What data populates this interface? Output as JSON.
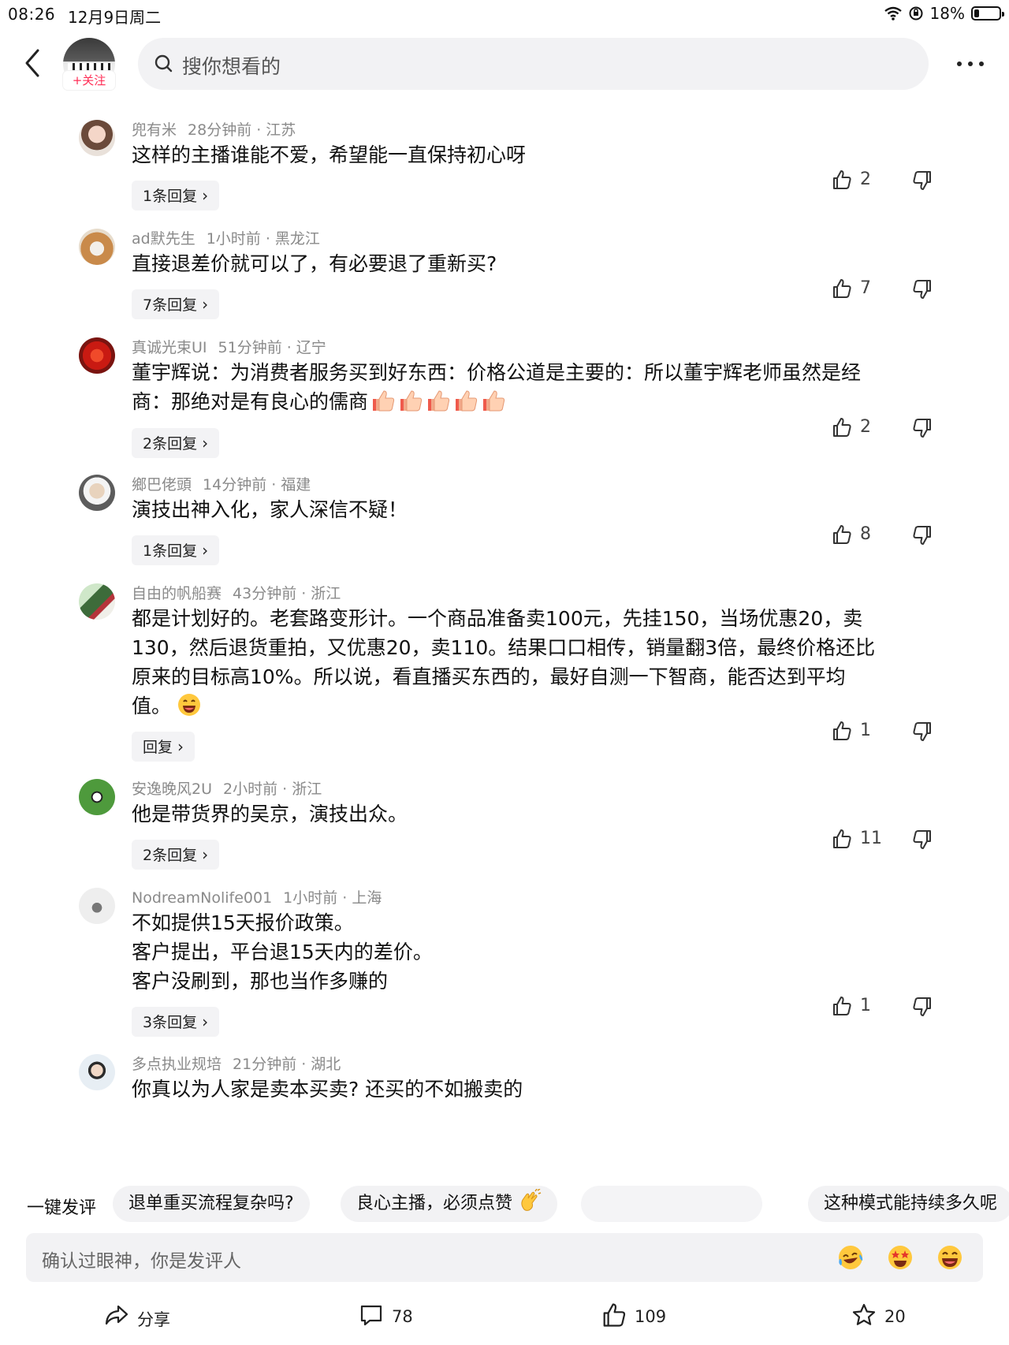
{
  "status_bar": {
    "time": "08:26",
    "date": "12月9日周二",
    "battery": "18%",
    "battery_level": 0.18
  },
  "header": {
    "follow_label": "+关注",
    "search_placeholder": "搜你想看的"
  },
  "comments": [
    {
      "user": "兜有米",
      "time": "28分钟前 · 江苏",
      "lines": [
        "这样的主播谁能不爱，希望能一直保持初心呀"
      ],
      "reply": "1条回复",
      "likes": "2"
    },
    {
      "user": "ad默先生",
      "time": "1小时前 · 黑龙江",
      "lines": [
        "直接退差价就可以了，有必要退了重新买?"
      ],
      "reply": "7条回复",
      "likes": "7"
    },
    {
      "user": "真诚光束UI",
      "time": "51分钟前 · 辽宁",
      "lines": [
        "董宇辉说：为消费者服务买到好东西：价格公道是主要的：所以董宇辉老师虽然是经",
        "商：那绝对是有良心的儒商"
      ],
      "emoji_count": 5,
      "reply": "2条回复",
      "likes": "2"
    },
    {
      "user": "鄉巴佬頭",
      "time": "14分钟前 · 福建",
      "lines": [
        "演技出神入化，家人深信不疑！"
      ],
      "reply": "1条回复",
      "likes": "8"
    },
    {
      "user": "自由的帆船赛",
      "time": "43分钟前 · 浙江",
      "lines": [
        "都是计划好的。老套路变形计。一个商品准备卖100元，先挂150，当场优惠20，卖",
        "130，然后退货重拍，又优惠20，卖110。结果口口相传，销量翻3倍，最终价格还比",
        "原来的目标高10%。所以说，看直播买东西的，最好自测一下智商，能否达到平均",
        "值。"
      ],
      "reply": "回复",
      "likes": "1"
    },
    {
      "user": "安逸晚风2U",
      "time": "2小时前 · 浙江",
      "lines": [
        "他是带货界的吴京，演技出众。"
      ],
      "reply": "2条回复",
      "likes": "11"
    },
    {
      "user": "NodreamNolife001",
      "time": "1小时前 · 上海",
      "lines": [
        "不如提供15天报价政策。",
        "客户提出，平台退15天内的差价。",
        "客户没刷到，那也当作多赚的"
      ],
      "reply": "3条回复",
      "likes": "1"
    },
    {
      "user": "多点执业规培",
      "time": "21分钟前 · 湖北",
      "lines": [
        "你真以为人家是卖本买卖? 还买的不如搬卖的"
      ]
    }
  ],
  "quick_comments": {
    "label": "一键发评",
    "chips": [
      "退单重买流程复杂吗?",
      "良心主播，必须点赞",
      "",
      "这种模式能持续多久呢"
    ]
  },
  "input": {
    "placeholder": "确认过眼神，你是发评人"
  },
  "bottom_bar": {
    "share": "分享",
    "comments": "78",
    "likes": "109",
    "favorites": "20"
  },
  "icons": {
    "back": "chevron-left-icon",
    "search": "search-icon",
    "more": "more-dots-icon",
    "like": "thumbs-up-icon",
    "dislike": "thumbs-down-icon",
    "share": "share-icon",
    "comment": "comment-icon",
    "favorite": "star-icon"
  }
}
